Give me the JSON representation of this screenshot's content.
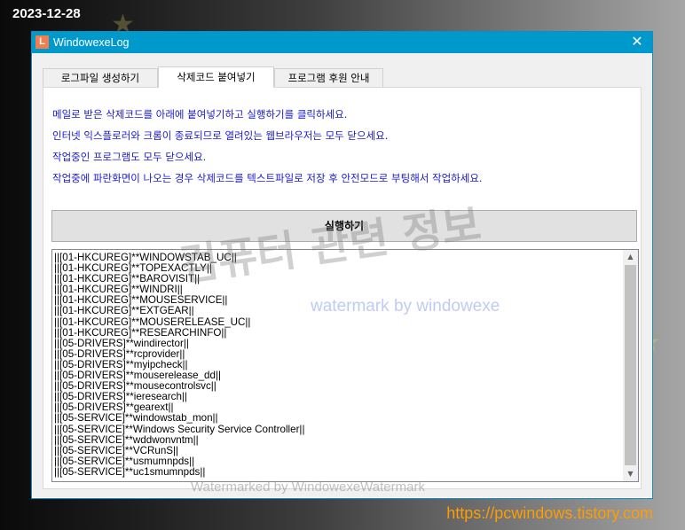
{
  "date_stamp": "2023-12-28",
  "site_url": "https://pcwindows.tistory.com",
  "window": {
    "title": "WindowexeLog",
    "icon_letter": "L",
    "close_glyph": "✕"
  },
  "tabs": [
    {
      "label": "로그파일 생성하기",
      "active": false
    },
    {
      "label": "삭제코드 붙여넣기",
      "active": true
    },
    {
      "label": "프로그램 후원 안내",
      "active": false
    }
  ],
  "instructions": [
    "메일로 받은 삭제코드를 아래에 붙여넣기하고 실행하기를 클릭하세요.",
    "인터넷 익스플로러와 크롬이 종료되므로 열려있는 웹브라우저는 모두 닫으세요.",
    "작업중인 프로그램도 모두 닫으세요.",
    "작업중에 파란화면이 나오는 경우 삭제코드를 텍스트파일로 저장 후 안전모드로 부팅해서 작업하세요."
  ],
  "run_button_label": "실행하기",
  "code_lines": [
    "||[01-HKCUREG]**WINDOWSTAB_UC||",
    "||[01-HKCUREG]**TOPEXACTLY||",
    "||[01-HKCUREG]**BAROVISIT||",
    "||[01-HKCUREG]**WINDRI||",
    "||[01-HKCUREG]**MOUSESERVICE||",
    "||[01-HKCUREG]**EXTGEAR||",
    "||[01-HKCUREG]**MOUSERELEASE_UC||",
    "||[01-HKCUREG]**RESEARCHINFO||",
    "||[05-DRIVERS]**windirector||",
    "||[05-DRIVERS]**rcprovider||",
    "||[05-DRIVERS]**myipcheck||",
    "||[05-DRIVERS]**mouserelease_dd||",
    "||[05-DRIVERS]**mousecontrolsvc||",
    "||[05-DRIVERS]**ieresearch||",
    "||[05-DRIVERS]**gearext||",
    "||[05-SERVICE]**windowstab_mon||",
    "||[05-SERVICE]**Windows Security Service Controller||",
    "||[05-SERVICE]**wddwonvntm||",
    "||[05-SERVICE]**VCRunS||",
    "||[05-SERVICE]**usmumnpds||",
    "||[05-SERVICE]**uc1smumnpds||"
  ],
  "scrollbar": {
    "up_glyph": "▲",
    "down_glyph": "▼"
  },
  "watermarks": {
    "korean": "컴퓨터 관련 정보",
    "blue": "watermark by windowexe",
    "bottom": "Watermarked by WindowexeWatermark"
  },
  "colors": {
    "titlebar": "#0099cc",
    "instruction_text": "#1a1ac8",
    "url_text": "#ff9d00"
  }
}
